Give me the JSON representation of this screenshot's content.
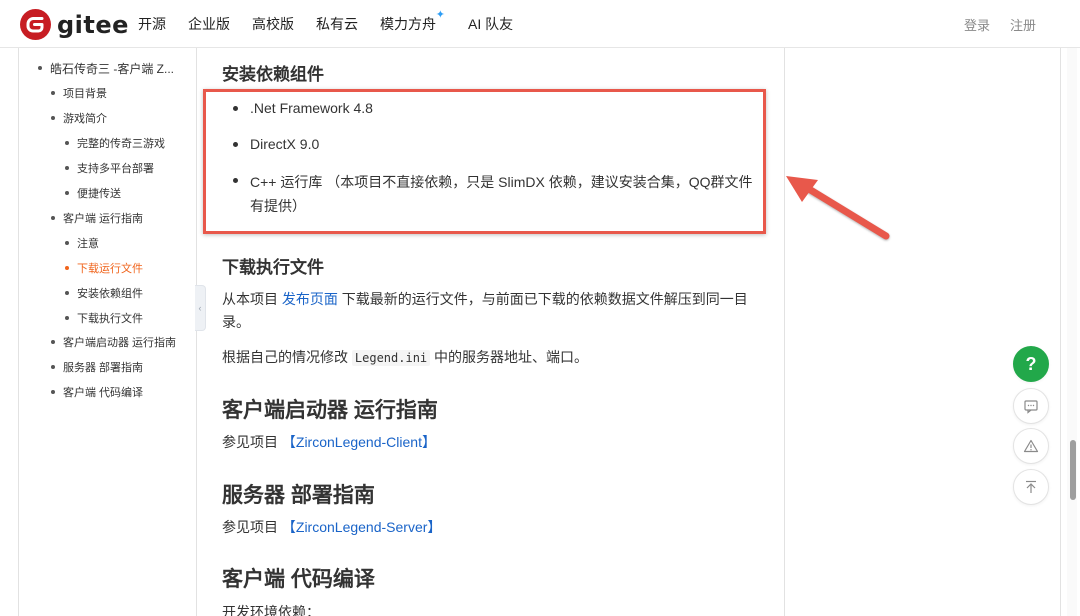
{
  "nav": {
    "logo_text": "gitee",
    "links": [
      "开源",
      "企业版",
      "高校版",
      "私有云",
      "模力方舟",
      "AI 队友"
    ],
    "login": "登录",
    "register": "注册"
  },
  "sidebar": {
    "items": [
      "皓石传奇三 -客户端 Z...",
      "项目背景",
      "游戏简介",
      "完整的传奇三游戏",
      "支持多平台部署",
      "便捷传送",
      "客户端 运行指南",
      "注意",
      "下载运行文件",
      "安装依赖组件",
      "下载执行文件",
      "客户端启动器 运行指南",
      "服务器 部署指南",
      "客户端 代码编译"
    ],
    "active_index": 8,
    "collapse_glyph": "‹"
  },
  "content": {
    "install_heading": "安装依赖组件",
    "deps": [
      ".Net Framework 4.8",
      "DirectX 9.0",
      "C++ 运行库 （本项目不直接依赖，只是 SlimDX 依赖，建议安装合集，QQ群文件有提供）"
    ],
    "download_heading": "下载执行文件",
    "download_para_1": "从本项目 ",
    "download_link": "发布页面",
    "download_para_2": " 下载最新的运行文件，与前面已下载的依赖数据文件解压到同一目录。",
    "config_para_1": "根据自己的情况修改 ",
    "config_code": "Legend.ini",
    "config_para_2": " 中的服务器地址、端口。",
    "launcher_heading": "客户端启动器 运行指南",
    "launcher_ref": "参见项目 ",
    "launcher_link": "【ZirconLegend-Client】",
    "server_heading": "服务器 部署指南",
    "server_ref": "参见项目 ",
    "server_link": "【ZirconLegend-Server】",
    "compile_heading": "客户端 代码编译",
    "compile_para": "开发环境依赖："
  },
  "fabs": {
    "help": "?",
    "comment": "comment-icon",
    "report": "warning-icon",
    "top": "back-to-top-icon"
  },
  "colors": {
    "brand": "#c71d23",
    "link": "#1a64c8",
    "active": "#f0641c",
    "highlight": "#e8584b",
    "help_fab": "#22a84a"
  }
}
